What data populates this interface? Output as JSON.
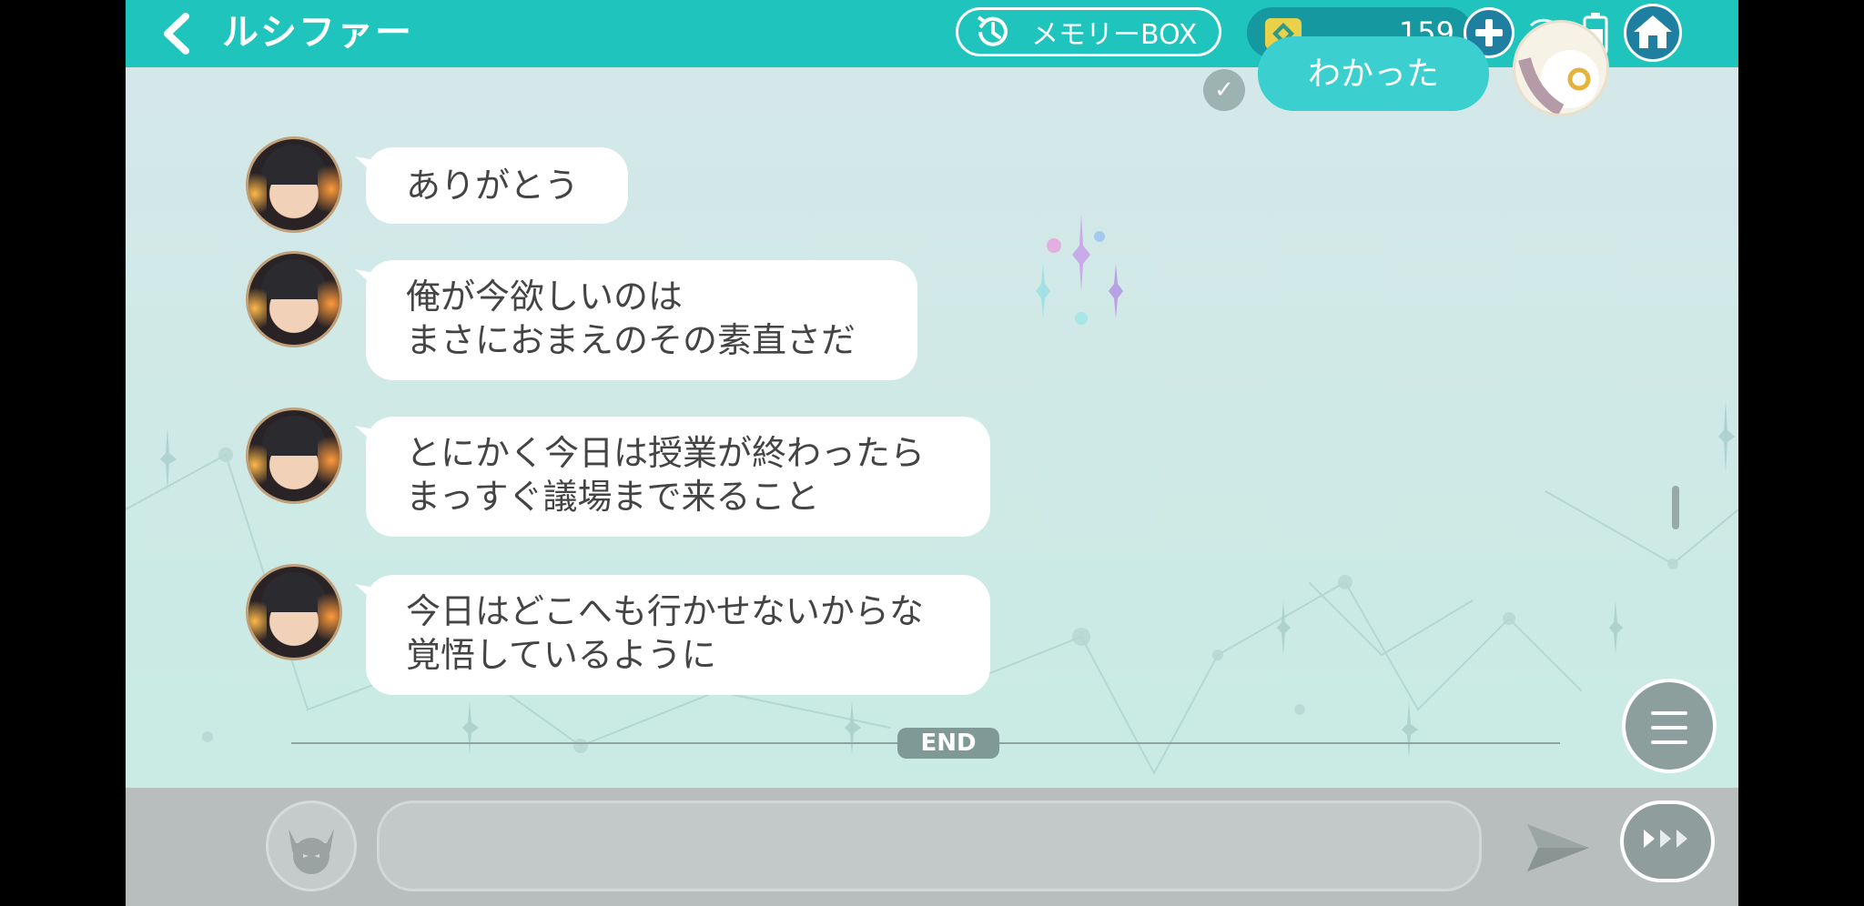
{
  "header": {
    "title": "ルシファー",
    "memory_box_label": "メモリーBOX",
    "gem_count": "159"
  },
  "chat": {
    "my_last_message": "わかった",
    "read_mark": "✓",
    "messages": [
      "ありがとう",
      "俺が今欲しいのは\nまさにおまえのその素直さだ",
      "とにかく今日は授業が終わったら\nまっすぐ議場まで来ること",
      "今日はどこへも行かせないからな\n覚悟しているように"
    ],
    "end_label": "END"
  },
  "input": {
    "value": "",
    "placeholder": ""
  },
  "colors": {
    "header": "#1fc4bd",
    "my_bubble": "#3ccfcf",
    "bottom_bar": "#b7bebd"
  },
  "icons": {
    "back": "chevron-left-icon",
    "memory": "history-clock-icon",
    "gem": "gem-icon",
    "plus": "plus-icon",
    "signal": "signal-icon",
    "battery": "battery-icon",
    "home": "home-icon",
    "menu": "hamburger-menu-icon",
    "devil": "devil-icon",
    "send": "send-icon",
    "auto": "fast-forward-icon"
  }
}
